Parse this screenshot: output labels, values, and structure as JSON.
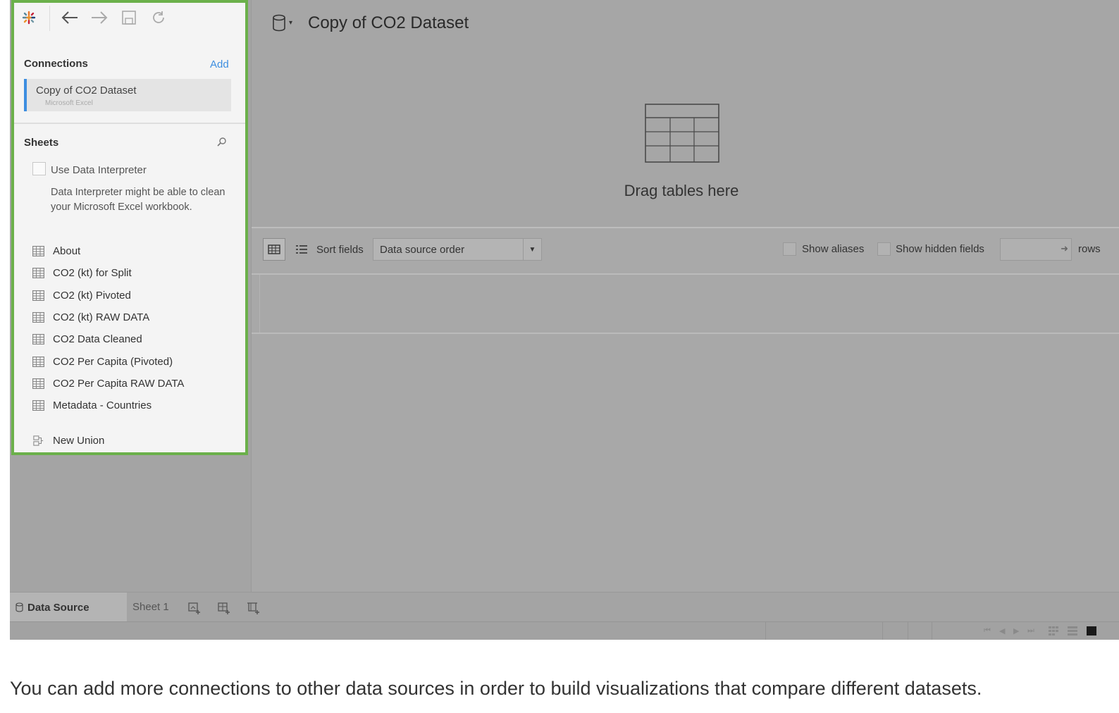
{
  "datasource": {
    "title": "Copy of CO2 Dataset",
    "drop_hint": "Drag tables here"
  },
  "connections": {
    "title": "Connections",
    "add_label": "Add",
    "items": [
      {
        "name": "Copy of CO2 Dataset",
        "type": "Microsoft Excel"
      }
    ]
  },
  "sheets": {
    "title": "Sheets",
    "interpreter_label": "Use Data Interpreter",
    "interpreter_desc": "Data Interpreter might be able to clean your Microsoft Excel workbook.",
    "items": [
      "About",
      "CO2 (kt) for Split",
      "CO2 (kt) Pivoted",
      "CO2 (kt) RAW DATA",
      "CO2 Data Cleaned",
      "CO2 Per Capita (Pivoted)",
      "CO2 Per Capita RAW DATA",
      "Metadata - Countries"
    ],
    "new_union_label": "New Union"
  },
  "grid_toolbar": {
    "sort_label": "Sort fields",
    "sort_value": "Data source order",
    "show_aliases": "Show aliases",
    "show_hidden": "Show hidden fields",
    "rows_label": "rows"
  },
  "tabs": {
    "data_source": "Data Source",
    "sheet1": "Sheet 1"
  },
  "caption": "You can add more connections to other data sources in order to build visualizations that compare different datasets.",
  "colors": {
    "highlight_border": "#6bb04a",
    "link_blue": "#3d8ee0"
  }
}
